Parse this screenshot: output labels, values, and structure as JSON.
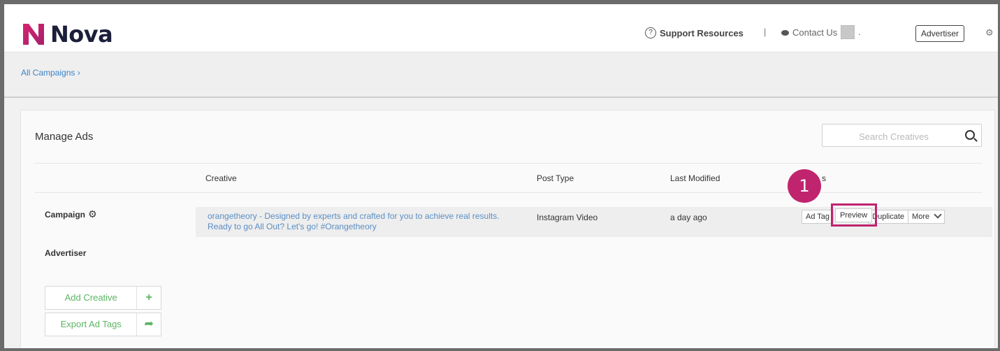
{
  "header": {
    "logo_text": "Nova",
    "support_label": "Support Resources",
    "separator": "|",
    "contact_label": "Contact Us",
    "avatar_suffix": ".",
    "role_button": "Advertiser"
  },
  "breadcrumb": {
    "label": "All Campaigns ›"
  },
  "panel": {
    "title": "Manage Ads",
    "search_placeholder": "Search Creatives"
  },
  "table": {
    "columns": [
      "Creative",
      "Post Type",
      "Last Modified",
      "s"
    ],
    "rows": [
      {
        "creative": "orangetheory - Designed by experts and crafted for you to achieve real results. Ready to go All Out? Let's go! #Orangetheory",
        "post_type": "Instagram Video",
        "last_modified": "a day ago",
        "actions": [
          "Ad Tag",
          "Preview",
          "Duplicate",
          "More"
        ]
      }
    ]
  },
  "sidebar": {
    "campaign_label": "Campaign",
    "advertiser_label": "Advertiser",
    "add_creative": "Add Creative",
    "export_ad_tags": "Export Ad Tags"
  },
  "annotation": {
    "step_number": "1"
  },
  "colors": {
    "brand": "#c0246f",
    "link": "#3a84c6",
    "accent_green": "#5bb464"
  }
}
